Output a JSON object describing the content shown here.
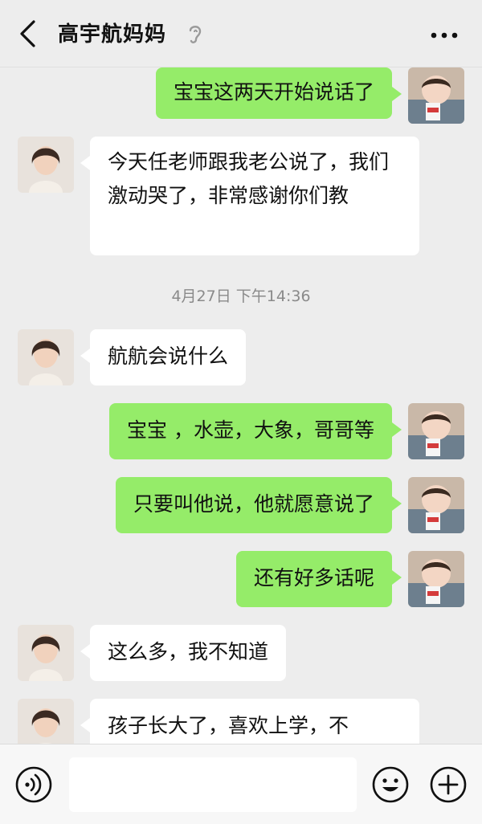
{
  "header": {
    "title": "高宇航妈妈",
    "back_icon": "chevron-left-icon",
    "mode_icon": "ear-icon",
    "more_icon": "more-dots-icon"
  },
  "messages": [
    {
      "side": "right",
      "text": "宝宝这两天开始说话了"
    },
    {
      "side": "left",
      "text": "今天任老师跟我老公说了，我们激动哭了，非常感谢你们教"
    },
    {
      "timestamp": "4月27日 下午14:36"
    },
    {
      "side": "left",
      "text": "航航会说什么"
    },
    {
      "side": "right",
      "text": "宝宝 ，水壶，大象，哥哥等"
    },
    {
      "side": "right",
      "text": "只要叫他说，他就愿意说了"
    },
    {
      "side": "right",
      "text": "还有好多话呢"
    },
    {
      "side": "left",
      "text": "这么多，我不知道"
    },
    {
      "side": "left",
      "text": "孩子长大了，喜欢上学，不"
    }
  ],
  "input_bar": {
    "voice_icon": "voice-icon",
    "input_value": "",
    "emoji_icon": "emoji-icon",
    "add_icon": "plus-circle-icon"
  },
  "colors": {
    "background": "#ededed",
    "outgoing_bubble": "#95ec69",
    "incoming_bubble": "#ffffff",
    "timestamp_text": "#8a8a8a"
  }
}
